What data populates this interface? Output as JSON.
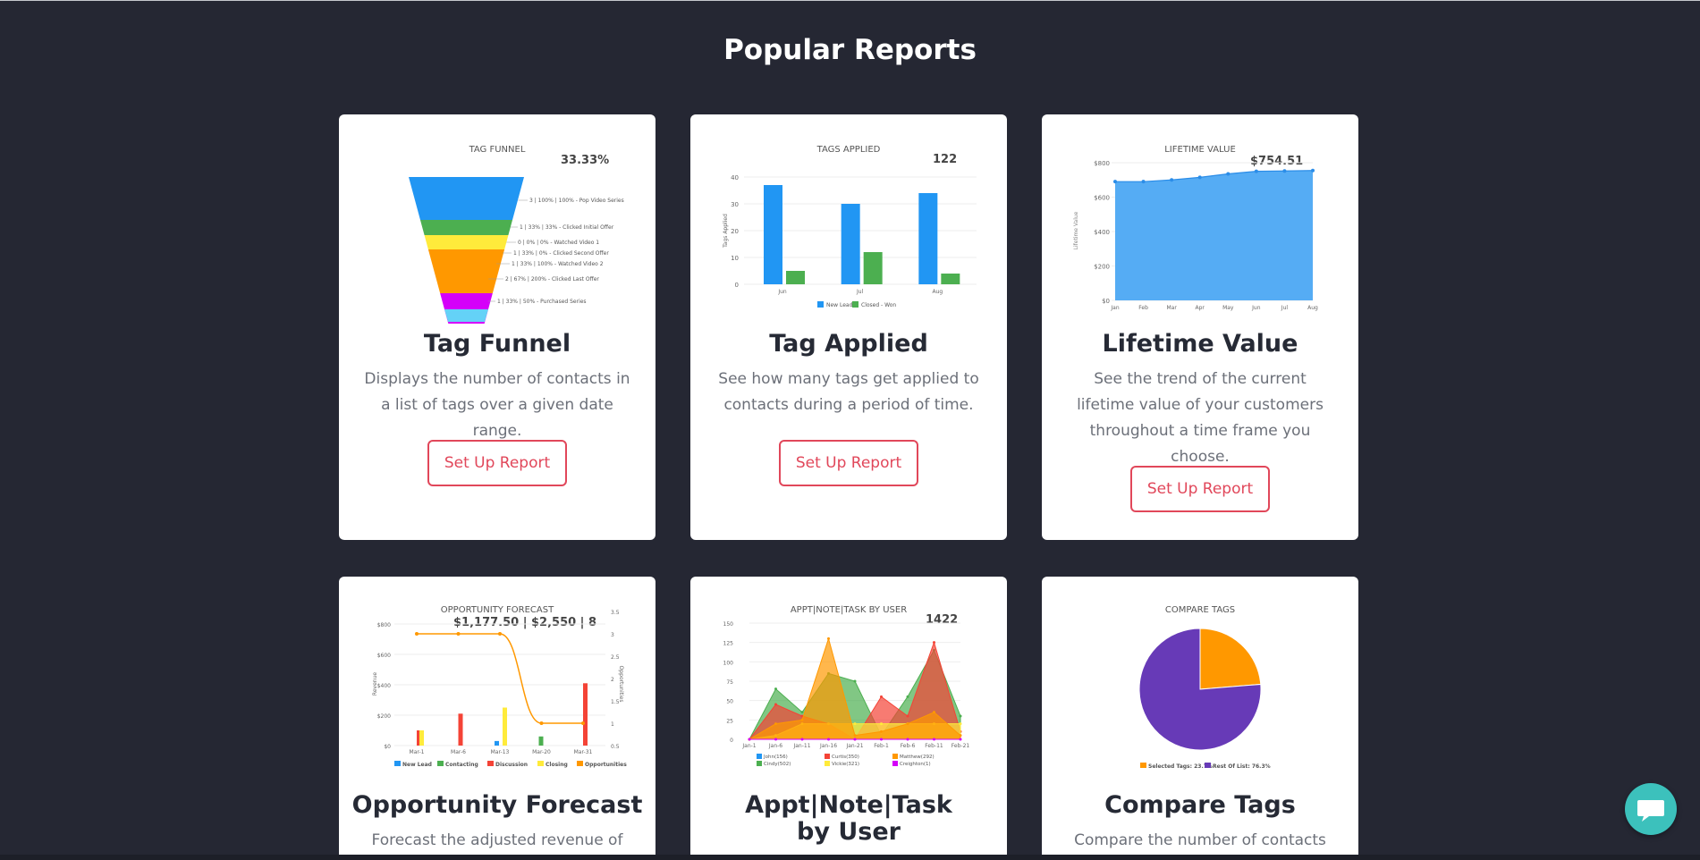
{
  "page": {
    "title": "Popular Reports"
  },
  "colors": {
    "background": "#252733",
    "card": "#ffffff",
    "accent": "#e1475a",
    "chat": "#3cc1bc"
  },
  "cards": [
    {
      "title": "Tag Funnel",
      "description": "Displays the number of contacts in a list of tags over a given date range.",
      "button": "Set Up Report",
      "chart_label": "TAG FUNNEL",
      "headline": "33.33%"
    },
    {
      "title": "Tag Applied",
      "description": "See how many tags get applied to contacts during a period of time.",
      "button": "Set Up Report",
      "chart_label": "TAGS APPLIED",
      "headline": "122"
    },
    {
      "title": "Lifetime Value",
      "description": "See the trend of the current lifetime value of your customers throughout a time frame you choose.",
      "button": "Set Up Report",
      "chart_label": "LIFETIME VALUE",
      "headline": "$754.51"
    },
    {
      "title": "Opportunity Forecast",
      "description": "Forecast the adjusted revenue of",
      "chart_label": "OPPORTUNITY FORECAST",
      "headline": "$1,177.50 | $2,550 | 8"
    },
    {
      "title": "Appt|Note|Task by User",
      "description": "",
      "chart_label": "APPT|NOTE|TASK BY USER",
      "headline": "1422"
    },
    {
      "title": "Compare Tags",
      "description": "Compare the number of contacts",
      "chart_label": "COMPARE TAGS",
      "headline": ""
    }
  ],
  "chart_data": [
    {
      "type": "funnel",
      "title": "TAG FUNNEL",
      "stages": [
        {
          "label": "3 | 100% | 100% - Pop Video Series",
          "value": 3,
          "color": "#2196f3"
        },
        {
          "label": "1 | 33% | 33% - Clicked Initial Offer",
          "value": 1,
          "color": "#4caf50"
        },
        {
          "label": "0 | 0% | 0% - Watched Video 1",
          "value": 0,
          "color": "#ffeb3b"
        },
        {
          "label": "1 | 33% | 0% - Clicked Second Offer",
          "value": 1,
          "color": "#ff9800"
        },
        {
          "label": "1 | 33% | 100% - Watched Video 2",
          "value": 1,
          "color": "#ff9800"
        },
        {
          "label": "2 | 67% | 200% - Clicked Last Offer",
          "value": 2,
          "color": "#d500f9"
        },
        {
          "label": "1 | 33% | 50% - Purchased Series",
          "value": 1,
          "color": "#64d2f7"
        }
      ]
    },
    {
      "type": "bar",
      "title": "TAGS APPLIED",
      "categories": [
        "Jun",
        "Jul",
        "Aug"
      ],
      "series": [
        {
          "name": "New Lead",
          "values": [
            37,
            30,
            34
          ],
          "color": "#2196f3"
        },
        {
          "name": "Closed - Won",
          "values": [
            5,
            12,
            4
          ],
          "color": "#4caf50"
        }
      ],
      "ylabel": "Tags Applied",
      "ylim": [
        0,
        40
      ],
      "yticks": [
        0,
        10,
        20,
        30,
        40
      ],
      "legend": "bottom"
    },
    {
      "type": "area",
      "title": "LIFETIME VALUE",
      "categories": [
        "Jan",
        "Feb",
        "Mar",
        "Apr",
        "May",
        "Jun",
        "Jul",
        "Aug"
      ],
      "values": [
        690,
        690,
        700,
        715,
        735,
        750,
        752,
        754.51
      ],
      "ylabel": "Lifetime Value",
      "ylim": [
        0,
        800
      ],
      "yticks": [
        "$0",
        "$200",
        "$400",
        "$600",
        "$800"
      ],
      "color": "#55acf4"
    },
    {
      "type": "bar",
      "title": "OPPORTUNITY FORECAST",
      "categories": [
        "Mar-1",
        "Mar-6",
        "Mar-13",
        "Mar-20",
        "Mar-31"
      ],
      "series": [
        {
          "name": "New Lead",
          "values": [
            0,
            0,
            30,
            0,
            0
          ],
          "color": "#2196f3"
        },
        {
          "name": "Contacting",
          "values": [
            0,
            0,
            0,
            60,
            0
          ],
          "color": "#4caf50"
        },
        {
          "name": "Discussion",
          "values": [
            100,
            210,
            0,
            0,
            410
          ],
          "color": "#f44336"
        },
        {
          "name": "Closing",
          "values": [
            100,
            0,
            250,
            0,
            0
          ],
          "color": "#ffeb3b"
        }
      ],
      "line": {
        "name": "Opportunities",
        "values": [
          3,
          3,
          3,
          1,
          1
        ],
        "color": "#ff9800"
      },
      "ylabel": "Revenue",
      "y2label": "Opportunities",
      "ylim": [
        0,
        800
      ],
      "yticks": [
        "$0",
        "$200",
        "$400",
        "$600",
        "$800"
      ],
      "y2ticks": [
        "0.5",
        "1",
        "1.5",
        "2",
        "2.5",
        "3",
        "3.5"
      ],
      "legend": "bottom"
    },
    {
      "type": "area",
      "title": "APPT|NOTE|TASK BY USER",
      "categories": [
        "Jan-1",
        "Jan-6",
        "Jan-11",
        "Jan-16",
        "Jan-21",
        "Feb-1",
        "Feb-6",
        "Feb-11",
        "Feb-21"
      ],
      "yticks": [
        0,
        25,
        50,
        75,
        100,
        125,
        150
      ],
      "series": [
        {
          "name": "John(156)",
          "color": "#2196f3"
        },
        {
          "name": "Cindy(502)",
          "values": [
            0,
            65,
            35,
            85,
            75,
            5,
            55,
            115,
            30
          ],
          "color": "#4caf50"
        },
        {
          "name": "Curtis(350)",
          "values": [
            0,
            45,
            30,
            20,
            0,
            55,
            30,
            125,
            10
          ],
          "color": "#f44336"
        },
        {
          "name": "Vickie(321)",
          "values": [
            0,
            5,
            20,
            20,
            20,
            20,
            20,
            20,
            20
          ],
          "color": "#ffeb3b"
        },
        {
          "name": "Matthew(292)",
          "values": [
            0,
            20,
            25,
            130,
            5,
            10,
            20,
            35,
            5
          ],
          "color": "#ff9800"
        },
        {
          "name": "Creighton(1)",
          "values": [
            0,
            0,
            0,
            0,
            0,
            0,
            0,
            0,
            0
          ],
          "color": "#d500f9"
        }
      ],
      "legend": "bottom"
    },
    {
      "type": "pie",
      "title": "COMPARE TAGS",
      "slices": [
        {
          "name": "Selected Tags: 23.7%",
          "value": 23.7,
          "color": "#ff9800"
        },
        {
          "name": "Rest Of List: 76.3%",
          "value": 76.3,
          "color": "#673ab7"
        }
      ],
      "legend": "bottom"
    }
  ]
}
